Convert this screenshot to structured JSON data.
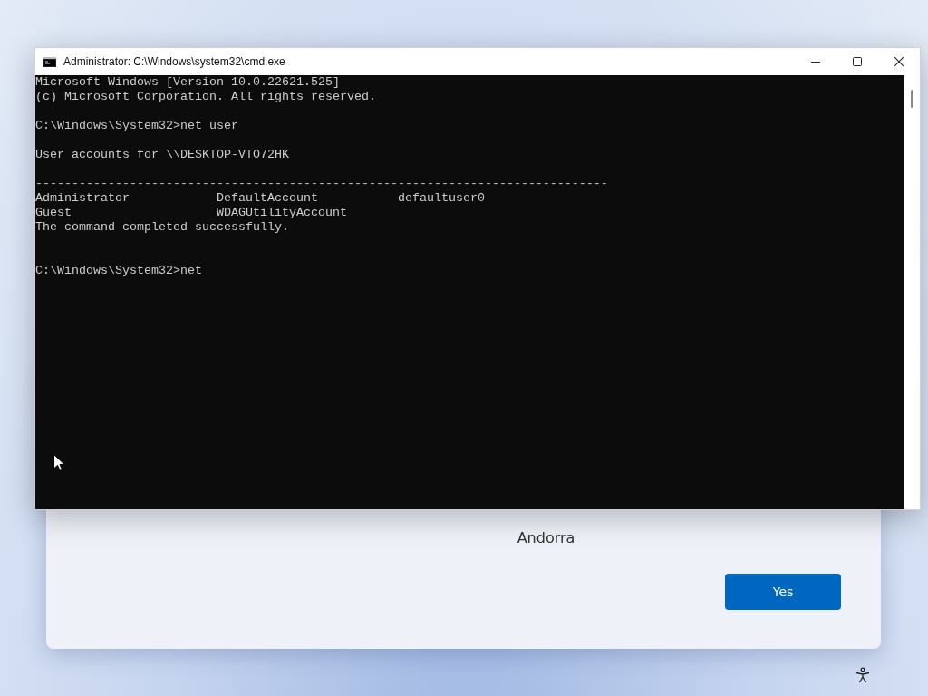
{
  "window": {
    "title": "Administrator: C:\\Windows\\system32\\cmd.exe"
  },
  "console": {
    "lines": [
      {
        "kind": "text",
        "text": "Microsoft Windows [Version 10.0.22621.525]"
      },
      {
        "kind": "text",
        "text": "(c) Microsoft Corporation. All rights reserved."
      },
      {
        "kind": "blank"
      },
      {
        "kind": "text",
        "text": "C:\\Windows\\System32>net user"
      },
      {
        "kind": "blank"
      },
      {
        "kind": "text",
        "text": "User accounts for \\\\DESKTOP-VTO72HK"
      },
      {
        "kind": "blank"
      },
      {
        "kind": "text",
        "text": "-------------------------------------------------------------------------------"
      },
      {
        "kind": "columns",
        "cells": [
          "Administrator",
          "DefaultAccount",
          "defaultuser0"
        ]
      },
      {
        "kind": "columns",
        "cells": [
          "Guest",
          "WDAGUtilityAccount"
        ]
      },
      {
        "kind": "text",
        "text": "The command completed successfully."
      },
      {
        "kind": "blank"
      },
      {
        "kind": "blank"
      },
      {
        "kind": "text",
        "text": "C:\\Windows\\System32>net"
      }
    ]
  },
  "dialog": {
    "region": "Andorra",
    "buttons": [
      {
        "label": "Yes"
      }
    ]
  }
}
